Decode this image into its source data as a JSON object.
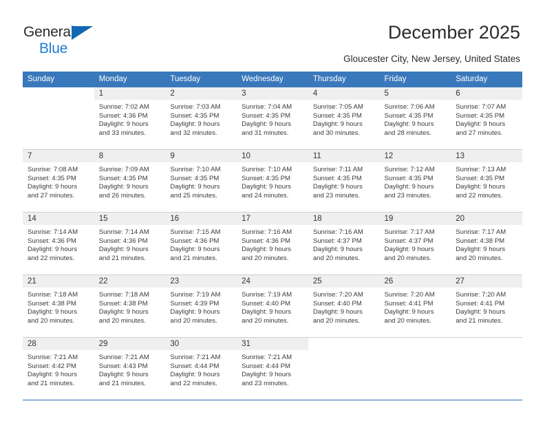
{
  "brand": {
    "name_part1": "General",
    "name_part2": "Blue",
    "triangle_color": "#1268b3",
    "blue_color": "#1a7fd4"
  },
  "header": {
    "title": "December 2025",
    "subtitle": "Gloucester City, New Jersey, United States"
  },
  "calendar": {
    "header_bg": "#3a78bc",
    "daynum_bg": "#efefef",
    "weekday_headers": [
      "Sunday",
      "Monday",
      "Tuesday",
      "Wednesday",
      "Thursday",
      "Friday",
      "Saturday"
    ],
    "weeks": [
      {
        "separator_color": "#cfcfcf",
        "days": [
          {
            "date": "",
            "empty": true,
            "sunrise": "",
            "sunset": "",
            "daylight_line1": "",
            "daylight_line2": ""
          },
          {
            "date": "1",
            "empty": false,
            "sunrise": "Sunrise: 7:02 AM",
            "sunset": "Sunset: 4:36 PM",
            "daylight_line1": "Daylight: 9 hours",
            "daylight_line2": "and 33 minutes."
          },
          {
            "date": "2",
            "empty": false,
            "sunrise": "Sunrise: 7:03 AM",
            "sunset": "Sunset: 4:35 PM",
            "daylight_line1": "Daylight: 9 hours",
            "daylight_line2": "and 32 minutes."
          },
          {
            "date": "3",
            "empty": false,
            "sunrise": "Sunrise: 7:04 AM",
            "sunset": "Sunset: 4:35 PM",
            "daylight_line1": "Daylight: 9 hours",
            "daylight_line2": "and 31 minutes."
          },
          {
            "date": "4",
            "empty": false,
            "sunrise": "Sunrise: 7:05 AM",
            "sunset": "Sunset: 4:35 PM",
            "daylight_line1": "Daylight: 9 hours",
            "daylight_line2": "and 30 minutes."
          },
          {
            "date": "5",
            "empty": false,
            "sunrise": "Sunrise: 7:06 AM",
            "sunset": "Sunset: 4:35 PM",
            "daylight_line1": "Daylight: 9 hours",
            "daylight_line2": "and 28 minutes."
          },
          {
            "date": "6",
            "empty": false,
            "sunrise": "Sunrise: 7:07 AM",
            "sunset": "Sunset: 4:35 PM",
            "daylight_line1": "Daylight: 9 hours",
            "daylight_line2": "and 27 minutes."
          }
        ]
      },
      {
        "separator_color": "#cfcfcf",
        "days": [
          {
            "date": "7",
            "empty": false,
            "sunrise": "Sunrise: 7:08 AM",
            "sunset": "Sunset: 4:35 PM",
            "daylight_line1": "Daylight: 9 hours",
            "daylight_line2": "and 27 minutes."
          },
          {
            "date": "8",
            "empty": false,
            "sunrise": "Sunrise: 7:09 AM",
            "sunset": "Sunset: 4:35 PM",
            "daylight_line1": "Daylight: 9 hours",
            "daylight_line2": "and 26 minutes."
          },
          {
            "date": "9",
            "empty": false,
            "sunrise": "Sunrise: 7:10 AM",
            "sunset": "Sunset: 4:35 PM",
            "daylight_line1": "Daylight: 9 hours",
            "daylight_line2": "and 25 minutes."
          },
          {
            "date": "10",
            "empty": false,
            "sunrise": "Sunrise: 7:10 AM",
            "sunset": "Sunset: 4:35 PM",
            "daylight_line1": "Daylight: 9 hours",
            "daylight_line2": "and 24 minutes."
          },
          {
            "date": "11",
            "empty": false,
            "sunrise": "Sunrise: 7:11 AM",
            "sunset": "Sunset: 4:35 PM",
            "daylight_line1": "Daylight: 9 hours",
            "daylight_line2": "and 23 minutes."
          },
          {
            "date": "12",
            "empty": false,
            "sunrise": "Sunrise: 7:12 AM",
            "sunset": "Sunset: 4:35 PM",
            "daylight_line1": "Daylight: 9 hours",
            "daylight_line2": "and 23 minutes."
          },
          {
            "date": "13",
            "empty": false,
            "sunrise": "Sunrise: 7:13 AM",
            "sunset": "Sunset: 4:35 PM",
            "daylight_line1": "Daylight: 9 hours",
            "daylight_line2": "and 22 minutes."
          }
        ]
      },
      {
        "separator_color": "#cfcfcf",
        "days": [
          {
            "date": "14",
            "empty": false,
            "sunrise": "Sunrise: 7:14 AM",
            "sunset": "Sunset: 4:36 PM",
            "daylight_line1": "Daylight: 9 hours",
            "daylight_line2": "and 22 minutes."
          },
          {
            "date": "15",
            "empty": false,
            "sunrise": "Sunrise: 7:14 AM",
            "sunset": "Sunset: 4:36 PM",
            "daylight_line1": "Daylight: 9 hours",
            "daylight_line2": "and 21 minutes."
          },
          {
            "date": "16",
            "empty": false,
            "sunrise": "Sunrise: 7:15 AM",
            "sunset": "Sunset: 4:36 PM",
            "daylight_line1": "Daylight: 9 hours",
            "daylight_line2": "and 21 minutes."
          },
          {
            "date": "17",
            "empty": false,
            "sunrise": "Sunrise: 7:16 AM",
            "sunset": "Sunset: 4:36 PM",
            "daylight_line1": "Daylight: 9 hours",
            "daylight_line2": "and 20 minutes."
          },
          {
            "date": "18",
            "empty": false,
            "sunrise": "Sunrise: 7:16 AM",
            "sunset": "Sunset: 4:37 PM",
            "daylight_line1": "Daylight: 9 hours",
            "daylight_line2": "and 20 minutes."
          },
          {
            "date": "19",
            "empty": false,
            "sunrise": "Sunrise: 7:17 AM",
            "sunset": "Sunset: 4:37 PM",
            "daylight_line1": "Daylight: 9 hours",
            "daylight_line2": "and 20 minutes."
          },
          {
            "date": "20",
            "empty": false,
            "sunrise": "Sunrise: 7:17 AM",
            "sunset": "Sunset: 4:38 PM",
            "daylight_line1": "Daylight: 9 hours",
            "daylight_line2": "and 20 minutes."
          }
        ]
      },
      {
        "separator_color": "#cfcfcf",
        "days": [
          {
            "date": "21",
            "empty": false,
            "sunrise": "Sunrise: 7:18 AM",
            "sunset": "Sunset: 4:38 PM",
            "daylight_line1": "Daylight: 9 hours",
            "daylight_line2": "and 20 minutes."
          },
          {
            "date": "22",
            "empty": false,
            "sunrise": "Sunrise: 7:18 AM",
            "sunset": "Sunset: 4:38 PM",
            "daylight_line1": "Daylight: 9 hours",
            "daylight_line2": "and 20 minutes."
          },
          {
            "date": "23",
            "empty": false,
            "sunrise": "Sunrise: 7:19 AM",
            "sunset": "Sunset: 4:39 PM",
            "daylight_line1": "Daylight: 9 hours",
            "daylight_line2": "and 20 minutes."
          },
          {
            "date": "24",
            "empty": false,
            "sunrise": "Sunrise: 7:19 AM",
            "sunset": "Sunset: 4:40 PM",
            "daylight_line1": "Daylight: 9 hours",
            "daylight_line2": "and 20 minutes."
          },
          {
            "date": "25",
            "empty": false,
            "sunrise": "Sunrise: 7:20 AM",
            "sunset": "Sunset: 4:40 PM",
            "daylight_line1": "Daylight: 9 hours",
            "daylight_line2": "and 20 minutes."
          },
          {
            "date": "26",
            "empty": false,
            "sunrise": "Sunrise: 7:20 AM",
            "sunset": "Sunset: 4:41 PM",
            "daylight_line1": "Daylight: 9 hours",
            "daylight_line2": "and 20 minutes."
          },
          {
            "date": "27",
            "empty": false,
            "sunrise": "Sunrise: 7:20 AM",
            "sunset": "Sunset: 4:41 PM",
            "daylight_line1": "Daylight: 9 hours",
            "daylight_line2": "and 21 minutes."
          }
        ]
      },
      {
        "separator_color": "#2a6db5",
        "days": [
          {
            "date": "28",
            "empty": false,
            "sunrise": "Sunrise: 7:21 AM",
            "sunset": "Sunset: 4:42 PM",
            "daylight_line1": "Daylight: 9 hours",
            "daylight_line2": "and 21 minutes."
          },
          {
            "date": "29",
            "empty": false,
            "sunrise": "Sunrise: 7:21 AM",
            "sunset": "Sunset: 4:43 PM",
            "daylight_line1": "Daylight: 9 hours",
            "daylight_line2": "and 21 minutes."
          },
          {
            "date": "30",
            "empty": false,
            "sunrise": "Sunrise: 7:21 AM",
            "sunset": "Sunset: 4:44 PM",
            "daylight_line1": "Daylight: 9 hours",
            "daylight_line2": "and 22 minutes."
          },
          {
            "date": "31",
            "empty": false,
            "sunrise": "Sunrise: 7:21 AM",
            "sunset": "Sunset: 4:44 PM",
            "daylight_line1": "Daylight: 9 hours",
            "daylight_line2": "and 23 minutes."
          },
          {
            "date": "",
            "empty": true,
            "sunrise": "",
            "sunset": "",
            "daylight_line1": "",
            "daylight_line2": ""
          },
          {
            "date": "",
            "empty": true,
            "sunrise": "",
            "sunset": "",
            "daylight_line1": "",
            "daylight_line2": ""
          },
          {
            "date": "",
            "empty": true,
            "sunrise": "",
            "sunset": "",
            "daylight_line1": "",
            "daylight_line2": ""
          }
        ]
      }
    ]
  }
}
